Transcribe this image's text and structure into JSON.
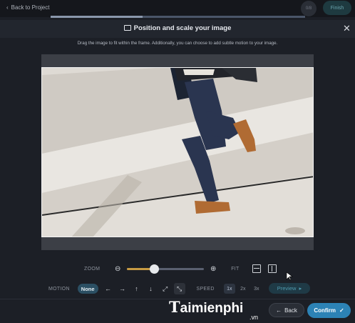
{
  "topbar": {
    "back_label": "Back to Project",
    "pager_label": "0/8",
    "finish_label": "Finish",
    "progress_fraction": 0.36
  },
  "modal": {
    "title": "Position and scale your image",
    "title_icon": "image-icon",
    "instruction": "Drag the image to fit within the frame. Additionally, you can choose to add subtle motion to your image.",
    "close_icon": "close-icon"
  },
  "zoom": {
    "label": "ZOOM",
    "value_fraction": 0.35,
    "zoom_out_icon": "zoom-out-icon",
    "zoom_in_icon": "zoom-in-icon"
  },
  "fit": {
    "label": "FIT",
    "options": [
      "fit-width-icon",
      "fit-height-icon"
    ]
  },
  "motion": {
    "label": "MOTION",
    "selected": "None",
    "directions": [
      {
        "icon": "arrow-left-icon",
        "glyph": "←"
      },
      {
        "icon": "arrow-right-icon",
        "glyph": "→"
      },
      {
        "icon": "arrow-up-icon",
        "glyph": "↑"
      },
      {
        "icon": "arrow-down-icon",
        "glyph": "↓"
      },
      {
        "icon": "expand-icon",
        "glyph": "⤢"
      },
      {
        "icon": "collapse-icon",
        "glyph": "⤡"
      }
    ]
  },
  "speed": {
    "label": "SPEED",
    "options": [
      "1x",
      "2x",
      "3x"
    ],
    "selected": "1x"
  },
  "preview_label": "Preview",
  "footer": {
    "back_label": "Back",
    "confirm_label": "Confirm"
  },
  "watermark": {
    "initial": "T",
    "rest": "aimienphi",
    "suffix": ".vn"
  },
  "colors": {
    "accent": "#2c82b5",
    "slider": "#c79b43",
    "chip": "#2b4f63"
  }
}
